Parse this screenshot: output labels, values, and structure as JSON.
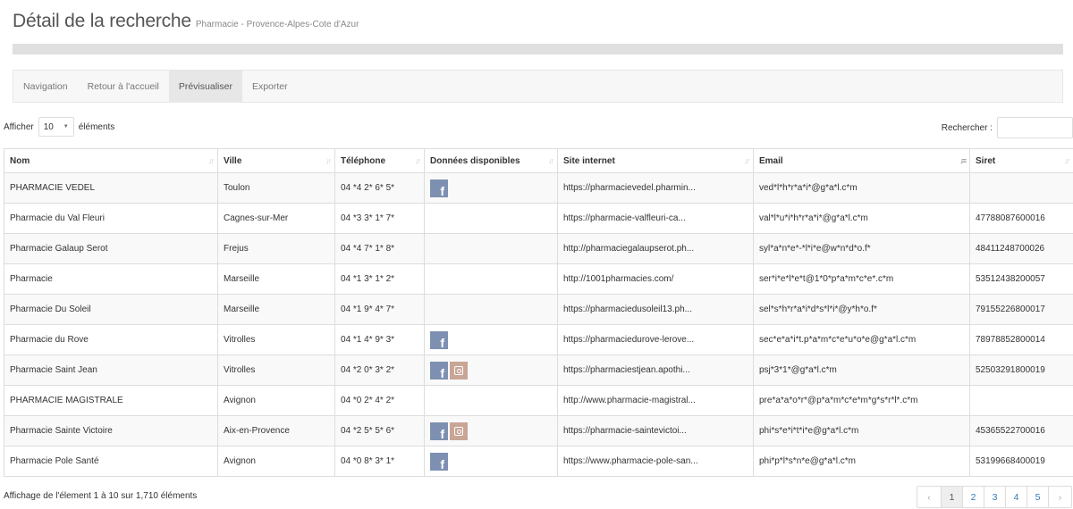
{
  "header": {
    "title": "Détail de la recherche",
    "subtitle": "Pharmacie - Provence-Alpes-Cote d'Azur"
  },
  "toolbar": {
    "items": [
      {
        "label": "Navigation",
        "active": false
      },
      {
        "label": "Retour à l'accueil",
        "active": false
      },
      {
        "label": "Prévisualiser",
        "active": true
      },
      {
        "label": "Exporter",
        "active": false
      }
    ]
  },
  "controls": {
    "show_label": "Afficher",
    "page_length": "10",
    "elements_label": "éléments",
    "search_label": "Rechercher :",
    "search_value": ""
  },
  "table": {
    "columns": [
      "Nom",
      "Ville",
      "Téléphone",
      "Données disponibles",
      "Site internet",
      "Email",
      "Siret"
    ],
    "sorted_column": "Email",
    "rows": [
      {
        "nom": "PHARMACIE VEDEL",
        "ville": "Toulon",
        "tel": "04 *4 2* 6* 5*",
        "icons": [
          "facebook-icon"
        ],
        "site": "https://pharmacievedel.pharmin...",
        "email": "ved*l*h*r*a*i*@g*a*l.c*m",
        "siret": ""
      },
      {
        "nom": "Pharmacie du Val Fleuri",
        "ville": "Cagnes-sur-Mer",
        "tel": "04 *3 3* 1* 7*",
        "icons": [],
        "site": "https://pharmacie-valfleuri-ca...",
        "email": "val*l*u*i*h*r*a*i*@g*a*l.c*m",
        "siret": "47788087600016"
      },
      {
        "nom": "Pharmacie Galaup Serot",
        "ville": "Frejus",
        "tel": "04 *4 7* 1* 8*",
        "icons": [],
        "site": "http://pharmaciegalaupserot.ph...",
        "email": "syl*a*n*e*-*l*i*e@w*n*d*o.f*",
        "siret": "48411248700026"
      },
      {
        "nom": "Pharmacie",
        "ville": "Marseille",
        "tel": "04 *1 3* 1* 2*",
        "icons": [],
        "site": "http://1001pharmacies.com/",
        "email": "ser*i*e*l*e*t@1*0*p*a*m*c*e*.c*m",
        "siret": "53512438200057"
      },
      {
        "nom": "Pharmacie Du Soleil",
        "ville": "Marseille",
        "tel": "04 *1 9* 4* 7*",
        "icons": [],
        "site": "https://pharmaciedusoleil13.ph...",
        "email": "sel*s*h*r*a*i*d*s*l*i*@y*h*o.f*",
        "siret": "79155226800017"
      },
      {
        "nom": "Pharmacie du Rove",
        "ville": "Vitrolles",
        "tel": "04 *1 4* 9* 3*",
        "icons": [
          "facebook-icon"
        ],
        "site": "https://pharmaciedurove-lerove...",
        "email": "sec*e*a*i*t.p*a*m*c*e*u*o*e@g*a*l.c*m",
        "siret": "78978852800014"
      },
      {
        "nom": "Pharmacie Saint Jean",
        "ville": "Vitrolles",
        "tel": "04 *2 0* 3* 2*",
        "icons": [
          "facebook-icon",
          "instagram-icon"
        ],
        "site": "https://pharmaciestjean.apothi...",
        "email": "psj*3*1*@g*a*l.c*m",
        "siret": "52503291800019"
      },
      {
        "nom": "PHARMACIE MAGISTRALE",
        "ville": "Avignon",
        "tel": "04 *0 2* 4* 2*",
        "icons": [],
        "site": "http://www.pharmacie-magistral...",
        "email": "pre*a*a*o*r*@p*a*m*c*e*m*g*s*r*l*.c*m",
        "siret": ""
      },
      {
        "nom": "Pharmacie Sainte Victoire",
        "ville": "Aix-en-Provence",
        "tel": "04 *2 5* 5* 6*",
        "icons": [
          "facebook-icon",
          "instagram-icon"
        ],
        "site": "https://pharmacie-saintevictoi...",
        "email": "phi*s*e*i*t*i*e@g*a*l.c*m",
        "siret": "45365522700016"
      },
      {
        "nom": "Pharmacie Pole Santé",
        "ville": "Avignon",
        "tel": "04 *0 8* 3* 1*",
        "icons": [
          "facebook-icon"
        ],
        "site": "https://www.pharmacie-pole-san...",
        "email": "phi*p*l*s*n*e@g*a*l.c*m",
        "siret": "53199668400019"
      }
    ]
  },
  "footer": {
    "info": "Affichage de l'élement 1 à 10 sur 1,710 éléments",
    "pages": [
      "1",
      "2",
      "3",
      "4",
      "5"
    ],
    "current_page": "1",
    "prev_glyph": "‹",
    "next_glyph": "›"
  },
  "colors": {
    "facebook": "#7e90b2",
    "instagram": "#c9a596",
    "link": "#337ab7"
  }
}
